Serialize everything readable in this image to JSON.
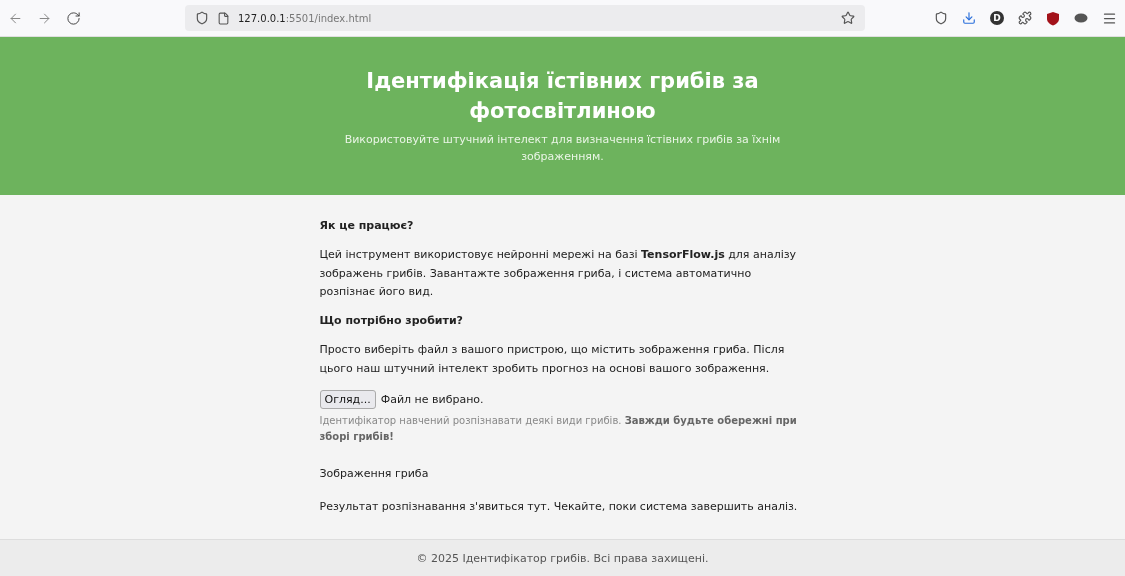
{
  "browser": {
    "url_host": "127.0.0.1",
    "url_rest": ":5501/index.html",
    "profile_badge": "D"
  },
  "header": {
    "title": "Ідентифікація їстівних грибів за фотосвітлиною",
    "subtitle": "Використовуйте штучний інтелект для визначення їстівних грибів за їхнім зображенням."
  },
  "sections": [
    {
      "kind": "heading",
      "text": "Як це працює?"
    },
    {
      "kind": "paragraph",
      "text": "Цей інструмент використовує нейронні мережі на базі **TensorFlow.js** для аналізу зображень грибів. Завантажте зображення гриба, і система автоматично розпізнає його вид."
    },
    {
      "kind": "heading",
      "text": "Що потрібно зробити?"
    },
    {
      "kind": "paragraph",
      "text": "Просто виберіть файл з вашого пристрою, що містить зображення гриба. Після цього наш штучний інтелект зробить прогноз на основі вашого зображення."
    }
  ],
  "upload": {
    "button": "Огляд...",
    "status": "Файл не вибрано.",
    "note": "Ідентифікатор навчений розпізнавати деякі види грибів. **Завжди будьте обережні при зборі грибів!**"
  },
  "image_label": "Зображення гриба",
  "result": "Результат розпізнавання з'явиться тут. Чекайте, поки система завершить аналіз.",
  "footer": "© 2025 Ідентифікатор грибів. Всі права захищені."
}
